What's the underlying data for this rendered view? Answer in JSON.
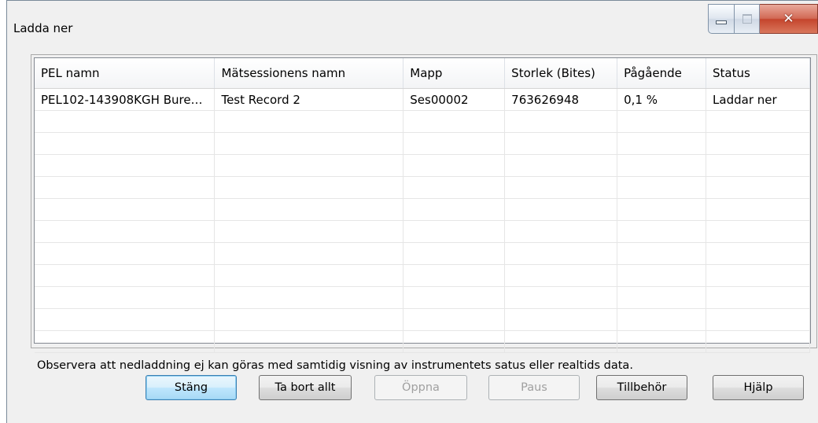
{
  "window": {
    "title": "Ladda ner"
  },
  "table": {
    "columns": [
      "PEL namn",
      "Mätsessionens namn",
      "Mapp",
      "Storlek (Bites)",
      "Pågående",
      "Status"
    ],
    "rows": [
      [
        "PEL102-143908KGH Bure…",
        "Test Record 2",
        "Ses00002",
        "763626948",
        "0,1 %",
        "Laddar ner"
      ],
      [
        "",
        "",
        "",
        "",
        "",
        ""
      ],
      [
        "",
        "",
        "",
        "",
        "",
        ""
      ],
      [
        "",
        "",
        "",
        "",
        "",
        ""
      ],
      [
        "",
        "",
        "",
        "",
        "",
        ""
      ],
      [
        "",
        "",
        "",
        "",
        "",
        ""
      ],
      [
        "",
        "",
        "",
        "",
        "",
        ""
      ],
      [
        "",
        "",
        "",
        "",
        "",
        ""
      ],
      [
        "",
        "",
        "",
        "",
        "",
        ""
      ],
      [
        "",
        "",
        "",
        "",
        "",
        ""
      ],
      [
        "",
        "",
        "",
        "",
        "",
        ""
      ],
      [
        "",
        "",
        "",
        "",
        "",
        ""
      ]
    ]
  },
  "notice": "Observera att nedladdning ej kan göras med samtidig visning av instrumentets satus eller realtids data.",
  "buttons": {
    "close": "Stäng",
    "remove_all": "Ta bort allt",
    "open": "Öppna",
    "pause": "Paus",
    "accessories": "Tillbehör",
    "help": "Hjälp"
  }
}
